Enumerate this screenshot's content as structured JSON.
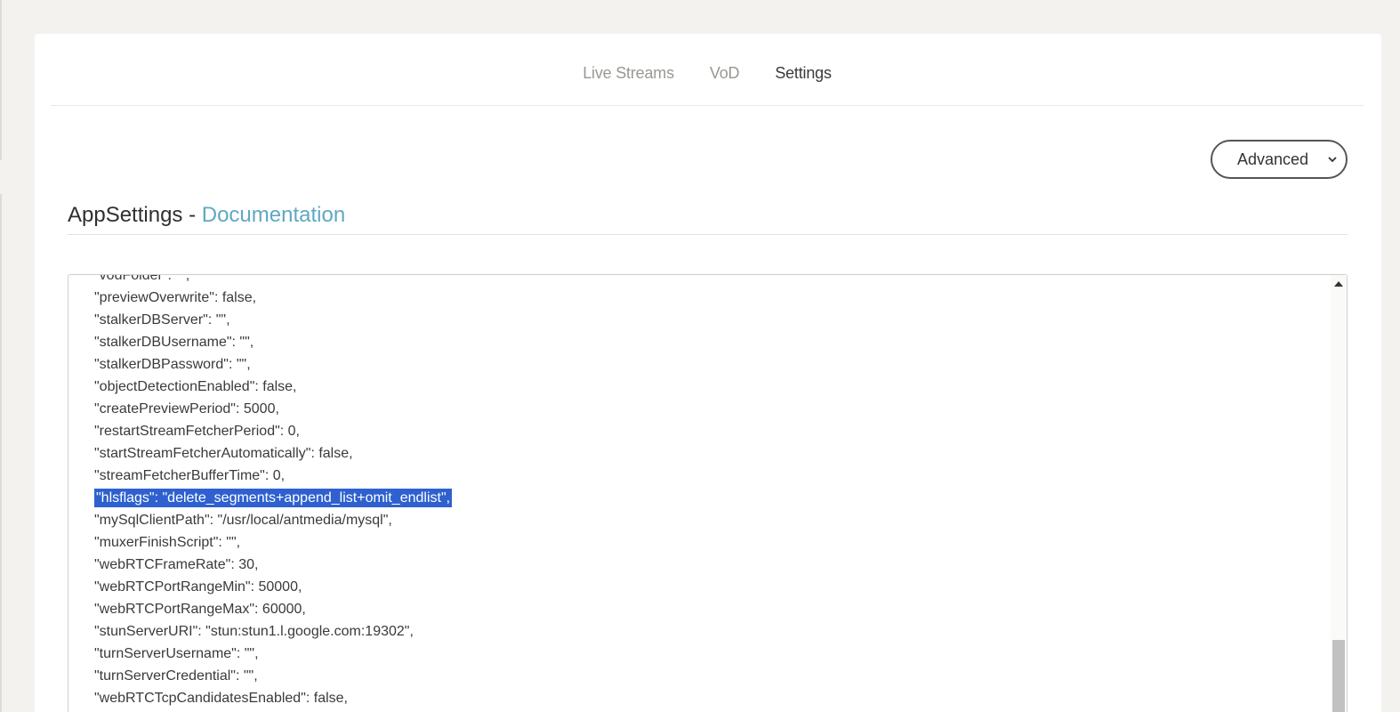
{
  "nav": {
    "tabs": [
      {
        "label": "Live Streams",
        "active": false
      },
      {
        "label": "VoD",
        "active": false
      },
      {
        "label": "Settings",
        "active": true
      }
    ]
  },
  "mode_select": {
    "value": "Advanced",
    "icon": "chevron-down-icon"
  },
  "section": {
    "title": "AppSettings",
    "separator": " - ",
    "link": "Documentation"
  },
  "editor": {
    "lines": [
      "\"vodFolder\": \"\",",
      "\"previewOverwrite\": false,",
      "\"stalkerDBServer\": \"\",",
      "\"stalkerDBUsername\": \"\",",
      "\"stalkerDBPassword\": \"\",",
      "\"objectDetectionEnabled\": false,",
      "\"createPreviewPeriod\": 5000,",
      "\"restartStreamFetcherPeriod\": 0,",
      "\"startStreamFetcherAutomatically\": false,",
      "\"streamFetcherBufferTime\": 0,",
      "\"hlsflags\": \"delete_segments+append_list+omit_endlist\",",
      "\"mySqlClientPath\": \"/usr/local/antmedia/mysql\",",
      "\"muxerFinishScript\": \"\",",
      "\"webRTCFrameRate\": 30,",
      "\"webRTCPortRangeMin\": 50000,",
      "\"webRTCPortRangeMax\": 60000,",
      "\"stunServerURI\": \"stun:stun1.l.google.com:19302\",",
      "\"turnServerUsername\": \"\",",
      "\"turnServerCredential\": \"\",",
      "\"webRTCTcpCandidatesEnabled\": false,"
    ],
    "selected_line_index": 10
  },
  "colors": {
    "link": "#5fa8c3",
    "selection": "#2e61cf",
    "background": "#f3f2ef"
  }
}
